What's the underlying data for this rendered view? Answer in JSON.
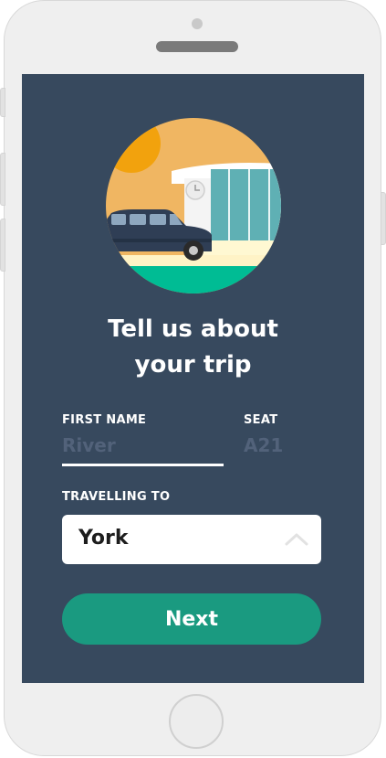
{
  "form": {
    "title_line1": "Tell us about",
    "title_line2": "your trip",
    "first_name_label": "FIRST NAME",
    "first_name_value": "River",
    "seat_label": "SEAT",
    "seat_value": "A21",
    "destination_label": "TRAVELLING TO",
    "destination_value": "York",
    "next_label": "Next"
  },
  "colors": {
    "screen_bg": "#37495e",
    "accent": "#1a9a80",
    "muted_text": "#52627a"
  },
  "icons": {
    "hero": "car-at-station-illustration",
    "select_toggle": "chevron-up-icon"
  }
}
